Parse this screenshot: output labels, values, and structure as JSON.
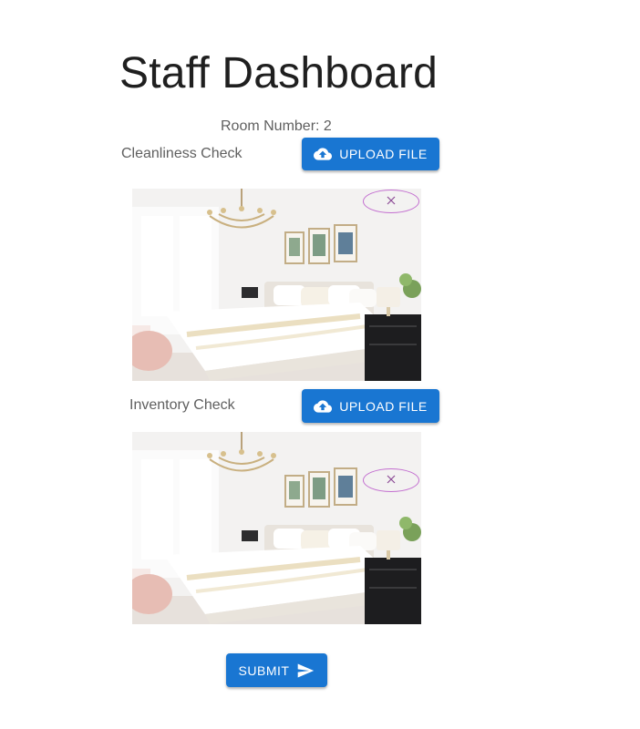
{
  "header": {
    "title": "Staff Dashboard",
    "room_label": "Room Number: 2"
  },
  "sections": [
    {
      "label": "Cleanliness Check",
      "upload_label": "UPLOAD FILE",
      "upload_icon": "cloud-upload-icon",
      "remove_icon": "close-icon"
    },
    {
      "label": "Inventory Check",
      "upload_label": "UPLOAD FILE",
      "upload_icon": "cloud-upload-icon",
      "remove_icon": "close-icon"
    }
  ],
  "submit": {
    "label": "SUBMIT",
    "icon": "send-icon"
  },
  "colors": {
    "primary": "#1976d2",
    "remove_outline": "#c36fd0"
  }
}
